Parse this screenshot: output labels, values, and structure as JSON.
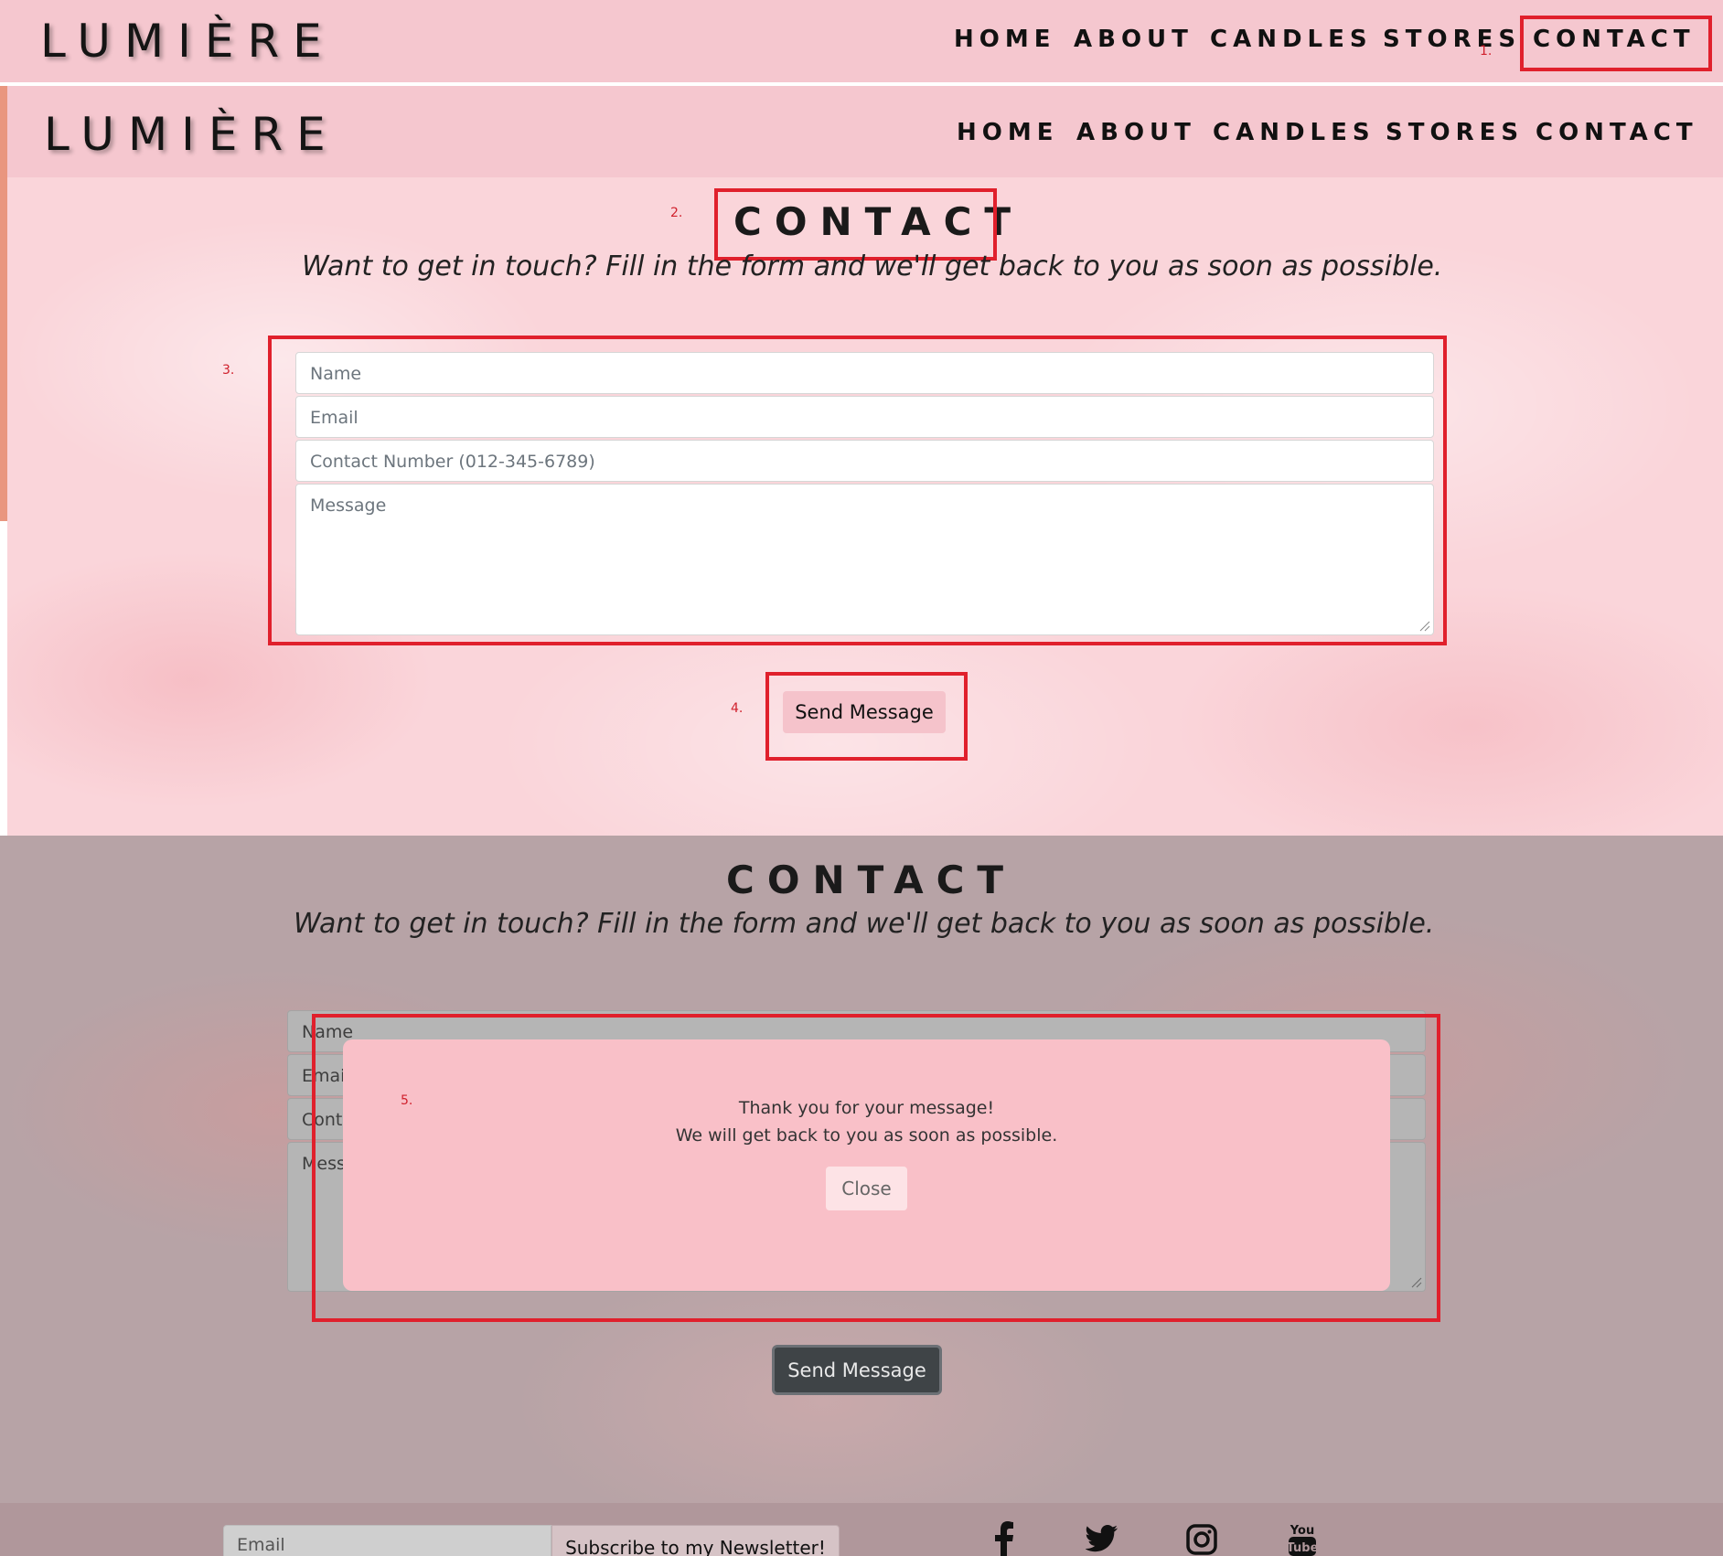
{
  "brand": {
    "name": "LUMIÈRE"
  },
  "nav": {
    "items": [
      "HOME",
      "ABOUT",
      "CANDLES",
      "STORES",
      "CONTACT"
    ]
  },
  "contact": {
    "heading": "CONTACT",
    "tagline": "Want to get in touch? Fill in the form and we'll get back to you as soon as possible.",
    "form": {
      "name_placeholder": "Name",
      "email_placeholder": "Email",
      "phone_placeholder": "Contact Number (012-345-6789)",
      "message_placeholder": "Message",
      "submit_label": "Send Message"
    }
  },
  "overlay": {
    "truncated_placeholders": [
      "Name",
      "Email",
      "Conta",
      "Mess"
    ],
    "modal": {
      "line1": "Thank you for your message!",
      "line2": "We will get back to you as soon as possible.",
      "close_label": "Close"
    }
  },
  "footer": {
    "email_placeholder": "Email",
    "subscribe_label": "Subscribe to my Newsletter!",
    "social_icons": [
      "facebook-icon",
      "twitter-icon",
      "instagram-icon",
      "youtube-icon"
    ]
  },
  "annotations": [
    "1.",
    "2.",
    "3.",
    "4.",
    "5."
  ],
  "colors": {
    "nav_pink": "#f5c7cf",
    "annotation_red": "#e0202c",
    "modal_pink": "#f9c0c8"
  }
}
